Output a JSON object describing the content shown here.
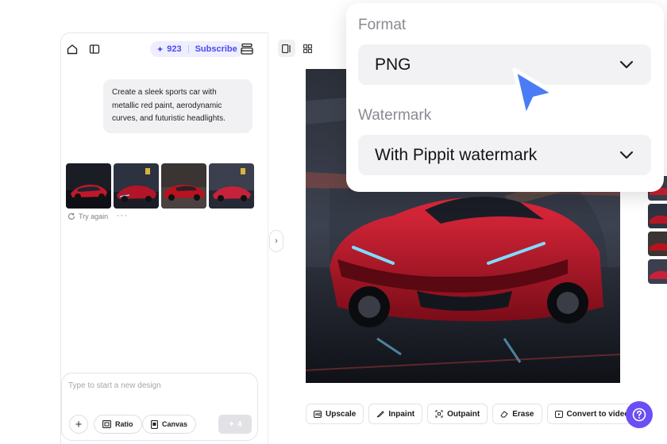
{
  "topbar": {
    "credits": "923",
    "subscribe_label": "Subscribe"
  },
  "chat": {
    "prompt": "Create a sleek sports car with metallic red paint, aerodynamic curves, and futuristic headlights.",
    "try_again_label": "Try again",
    "thumbnails": [
      "variation-1",
      "variation-2",
      "variation-3",
      "variation-4"
    ]
  },
  "composer": {
    "placeholder": "Type to start a new design",
    "ratio_label": "Ratio",
    "canvas_label": "Canvas",
    "send_cost": "4"
  },
  "toolbar": {
    "upscale_label": "Upscale",
    "inpaint_label": "Inpaint",
    "outpaint_label": "Outpaint",
    "erase_label": "Erase",
    "convert_label": "Convert to video"
  },
  "export_popover": {
    "format_label": "Format",
    "format_value": "PNG",
    "watermark_label": "Watermark",
    "watermark_value": "With Pippit watermark"
  },
  "colors": {
    "accent": "#4a4af0",
    "help_button": "#6b4ef5",
    "cursor": "#4a7cf5"
  }
}
